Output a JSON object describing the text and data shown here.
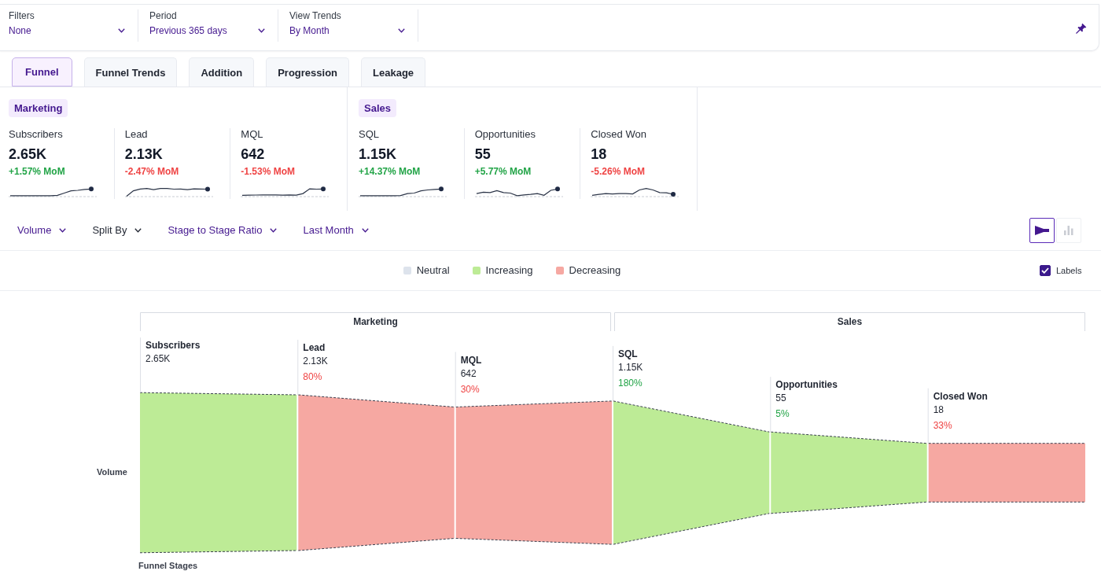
{
  "filter_bar": {
    "filters": [
      {
        "label": "Filters",
        "value": "None"
      },
      {
        "label": "Period",
        "value": "Previous 365 days"
      },
      {
        "label": "View Trends",
        "value": "By Month"
      }
    ]
  },
  "tabs": [
    {
      "label": "Funnel",
      "selected": true
    },
    {
      "label": "Funnel Trends",
      "selected": false
    },
    {
      "label": "Addition",
      "selected": false
    },
    {
      "label": "Progression",
      "selected": false
    },
    {
      "label": "Leakage",
      "selected": false
    }
  ],
  "kpi_groups": [
    {
      "label": "Marketing",
      "cards": [
        {
          "label": "Subscribers",
          "value": "2.65K",
          "change": "+1.57% MoM",
          "increase": true
        },
        {
          "label": "Lead",
          "value": "2.13K",
          "change": "-2.47% MoM",
          "increase": false
        },
        {
          "label": "MQL",
          "value": "642",
          "change": "-1.53% MoM",
          "increase": false
        }
      ]
    },
    {
      "label": "Sales",
      "cards": [
        {
          "label": "SQL",
          "value": "1.15K",
          "change": "+14.37% MoM",
          "increase": true
        },
        {
          "label": "Opportunities",
          "value": "55",
          "change": "+5.77% MoM",
          "increase": true
        },
        {
          "label": "Closed Won",
          "value": "18",
          "change": "-5.26% MoM",
          "increase": false
        }
      ]
    }
  ],
  "controls": {
    "dropdowns": [
      {
        "label": "Volume",
        "active": true
      },
      {
        "label": "Split By",
        "active": false
      },
      {
        "label": "Stage to Stage Ratio",
        "active": true
      },
      {
        "label": "Last Month",
        "active": true
      }
    ],
    "view_toggle": [
      {
        "kind": "funnel",
        "selected": true
      },
      {
        "kind": "bar",
        "selected": false
      }
    ]
  },
  "legend": {
    "items": [
      {
        "label": "Neutral",
        "color": "#dde3ec"
      },
      {
        "label": "Increasing",
        "color": "#bdeb96"
      },
      {
        "label": "Decreasing",
        "color": "#f6a8a2"
      }
    ],
    "labels_toggle": {
      "label": "Labels",
      "checked": true
    }
  },
  "funnel": {
    "groups": [
      {
        "label": "Marketing"
      },
      {
        "label": "Sales"
      }
    ],
    "stage_ratios": [
      {
        "label": "80%",
        "increase": false
      },
      {
        "label": "30%",
        "increase": false
      },
      {
        "label": "180%",
        "increase": true
      },
      {
        "label": "5%",
        "increase": true
      },
      {
        "label": "33%",
        "increase": false
      }
    ],
    "chart_data": [
      {
        "type": "other",
        "xlabel": "Funnel Stages",
        "ylabel": "Volume",
        "categories": [
          "Subscribers",
          "Lead",
          "MQL",
          "SQL",
          "Opportunities",
          "Closed Won"
        ],
        "values": [
          2650,
          2130,
          642,
          1150,
          55,
          18
        ],
        "value_labels": [
          "2.65K",
          "2.13K",
          "642",
          "1.15K",
          "55",
          "18"
        ],
        "colors": [
          "#bdeb96",
          "#f6a8a2",
          "#f6a8a2",
          "#bdeb96",
          "#bdeb96",
          "#f6a8a2"
        ]
      }
    ]
  }
}
